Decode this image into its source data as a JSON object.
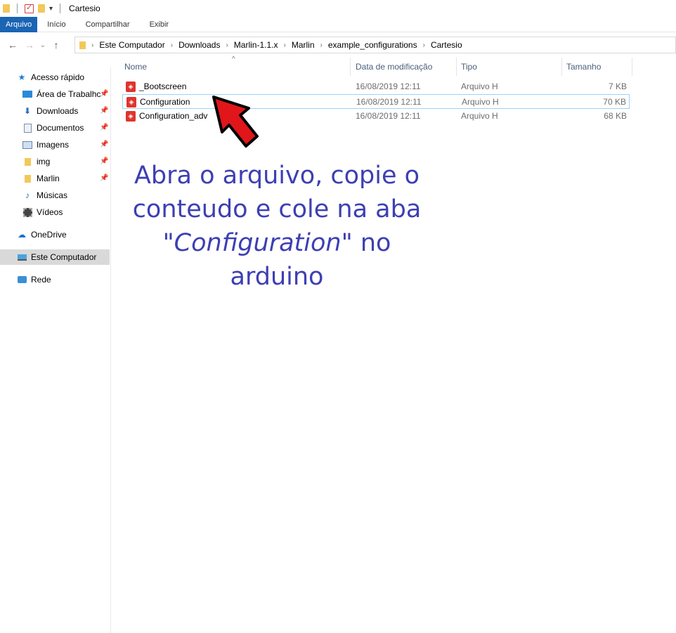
{
  "window": {
    "title": "Cartesio"
  },
  "ribbon": {
    "tabs": [
      "Arquivo",
      "Início",
      "Compartilhar",
      "Exibir"
    ]
  },
  "address": {
    "breadcrumbs": [
      "Este Computador",
      "Downloads",
      "Marlin-1.1.x",
      "Marlin",
      "example_configurations",
      "Cartesio"
    ]
  },
  "sidebar": {
    "quick_access": "Acesso rápido",
    "items": [
      {
        "label": "Área de Trabalhc",
        "icon": "desktop-icon",
        "pinned": true
      },
      {
        "label": "Downloads",
        "icon": "download-icon",
        "pinned": true
      },
      {
        "label": "Documentos",
        "icon": "documents-icon",
        "pinned": true
      },
      {
        "label": "Imagens",
        "icon": "pictures-icon",
        "pinned": true
      },
      {
        "label": "img",
        "icon": "folder-icon",
        "pinned": true
      },
      {
        "label": "Marlin",
        "icon": "folder-icon",
        "pinned": true
      },
      {
        "label": "Músicas",
        "icon": "music-icon",
        "pinned": false
      },
      {
        "label": "Vídeos",
        "icon": "videos-icon",
        "pinned": false
      }
    ],
    "onedrive": "OneDrive",
    "this_pc": "Este Computador",
    "network": "Rede"
  },
  "columns": {
    "name": "Nome",
    "date": "Data de modificação",
    "type": "Tipo",
    "size": "Tamanho"
  },
  "files": [
    {
      "name": "_Bootscreen",
      "date": "16/08/2019 12:11",
      "type": "Arquivo H",
      "size": "7 KB"
    },
    {
      "name": "Configuration",
      "date": "16/08/2019 12:11",
      "type": "Arquivo H",
      "size": "70 KB"
    },
    {
      "name": "Configuration_adv",
      "date": "16/08/2019 12:11",
      "type": "Arquivo H",
      "size": "68 KB"
    }
  ],
  "annotation": {
    "line1": "Abra o arquivo, copie o",
    "line2": "conteudo e cole na aba",
    "line3_italic": "\"Configuration\"",
    "line3_rest": " no arduino",
    "color": "#3d3fb3"
  },
  "colors": {
    "accent": "#1a64b4",
    "arrow": "#e0161b",
    "file_icon": "#e0342e"
  }
}
